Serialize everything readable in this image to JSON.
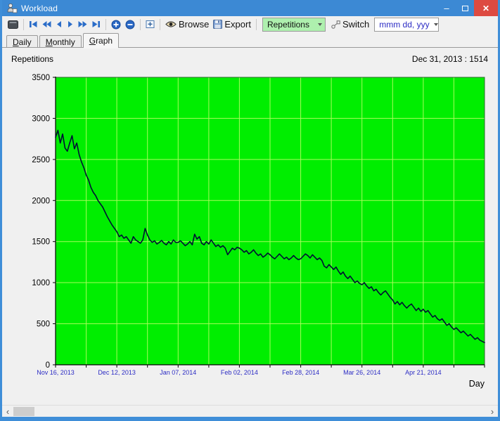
{
  "window": {
    "title": "Workload"
  },
  "icons": {
    "minimize": "–",
    "close": "✕",
    "scroll_left": "‹",
    "scroll_right": "›"
  },
  "toolbar": {
    "browse_label": "Browse",
    "export_label": "Export",
    "series_value": "Repetitions",
    "switch_label": "Switch",
    "date_format_value": "mmm dd, yyy"
  },
  "tabs": [
    {
      "first": "D",
      "rest": "aily"
    },
    {
      "first": "M",
      "rest": "onthly"
    },
    {
      "first": "G",
      "rest": "raph"
    }
  ],
  "header": {
    "series": "Repetitions",
    "cursor_readout": "Dec 31, 2013 : 1514"
  },
  "chart_data": {
    "type": "line",
    "title": "Repetitions",
    "xlabel": "Day",
    "ylabel": "Repetitions",
    "xlim_days": [
      0,
      182
    ],
    "x_tick_step_days": 13,
    "x_tick_labels": [
      {
        "day": 0,
        "label": "Nov 16, 2013"
      },
      {
        "day": 26,
        "label": "Dec 12, 2013"
      },
      {
        "day": 52,
        "label": "Jan 07, 2014"
      },
      {
        "day": 78,
        "label": "Feb 02, 2014"
      },
      {
        "day": 104,
        "label": "Feb 28, 2014"
      },
      {
        "day": 130,
        "label": "Mar 26, 2014"
      },
      {
        "day": 156,
        "label": "Apr 21, 2014"
      }
    ],
    "ylim": [
      0,
      3500
    ],
    "y_tick_step": 500,
    "grid": true,
    "legend": "none",
    "plot_bg": "#00ee00",
    "grid_color": "#a8fc5c",
    "line_color": "#001133",
    "x_label_color": "#2b2bc4",
    "values": [
      2770,
      2855,
      2700,
      2810,
      2640,
      2600,
      2700,
      2790,
      2630,
      2700,
      2560,
      2470,
      2400,
      2310,
      2250,
      2160,
      2100,
      2060,
      2000,
      1960,
      1920,
      1860,
      1800,
      1750,
      1700,
      1660,
      1620,
      1560,
      1580,
      1540,
      1560,
      1520,
      1480,
      1560,
      1520,
      1500,
      1480,
      1520,
      1660,
      1580,
      1520,
      1490,
      1510,
      1470,
      1490,
      1514,
      1480,
      1460,
      1500,
      1470,
      1520,
      1490,
      1490,
      1510,
      1480,
      1450,
      1470,
      1500,
      1460,
      1590,
      1530,
      1560,
      1480,
      1460,
      1500,
      1470,
      1520,
      1480,
      1440,
      1460,
      1430,
      1450,
      1420,
      1340,
      1380,
      1420,
      1400,
      1430,
      1420,
      1400,
      1370,
      1390,
      1350,
      1370,
      1400,
      1360,
      1330,
      1350,
      1310,
      1330,
      1360,
      1340,
      1310,
      1290,
      1320,
      1350,
      1320,
      1290,
      1310,
      1280,
      1300,
      1330,
      1300,
      1280,
      1290,
      1320,
      1350,
      1330,
      1300,
      1340,
      1310,
      1280,
      1300,
      1270,
      1200,
      1180,
      1220,
      1190,
      1160,
      1190,
      1140,
      1100,
      1130,
      1080,
      1050,
      1080,
      1040,
      1000,
      1020,
      990,
      975,
      1000,
      960,
      930,
      950,
      900,
      920,
      880,
      850,
      880,
      900,
      860,
      820,
      790,
      740,
      770,
      730,
      760,
      720,
      690,
      720,
      740,
      700,
      660,
      690,
      650,
      676,
      640,
      660,
      620,
      580,
      600,
      560,
      540,
      560,
      520,
      480,
      500,
      460,
      430,
      450,
      420,
      390,
      410,
      380,
      350,
      370,
      340,
      310,
      330,
      300,
      285,
      270
    ]
  }
}
